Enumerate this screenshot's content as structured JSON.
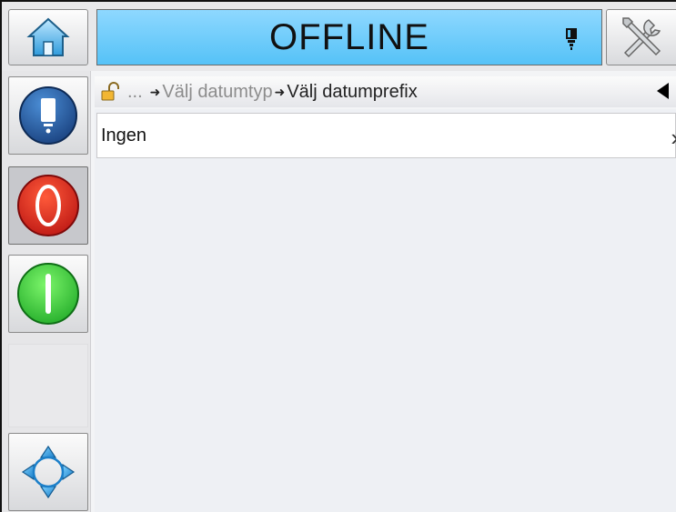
{
  "status": {
    "text": "OFFLINE",
    "color": "#58c3f7"
  },
  "breadcrumb": {
    "ellipsis": "...",
    "items": [
      "Välj datumtyp",
      "Välj datumprefix"
    ],
    "separator": "➜"
  },
  "list": {
    "items": [
      {
        "label": "Ingen"
      }
    ]
  },
  "icons": {
    "home": "home-icon",
    "ink": "ink-cartridge-icon",
    "tools": "tools-icon",
    "printer": "printer-status-icon",
    "stop": "stop-icon",
    "start": "start-icon",
    "navigate": "navigate-arrows-icon",
    "lock": "lock-open-icon"
  }
}
